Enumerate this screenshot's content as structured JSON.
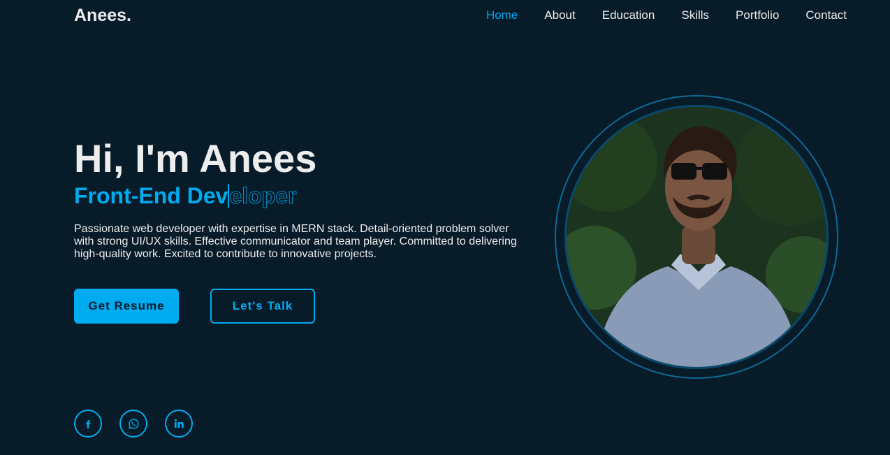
{
  "header": {
    "logo": "Anees.",
    "nav": [
      "Home",
      "About",
      "Education",
      "Skills",
      "Portfolio",
      "Contact"
    ],
    "active": "Home"
  },
  "hero": {
    "greeting": "Hi, I'm Anees",
    "role_typed": "Front-End Dev",
    "role_rest": "eloper",
    "description": "Passionate web developer with expertise in MERN stack. Detail-oriented problem solver with strong UI/UX skills. Effective communicator and team player. Committed to delivering high-quality work. Excited to contribute to innovative projects.",
    "primary_button": "Get Resume",
    "secondary_button": "Let's Talk"
  },
  "social": [
    "facebook-icon",
    "whatsapp-icon",
    "linkedin-icon"
  ],
  "colors": {
    "background": "#081b29",
    "accent": "#00abf0",
    "text": "#ededed"
  }
}
